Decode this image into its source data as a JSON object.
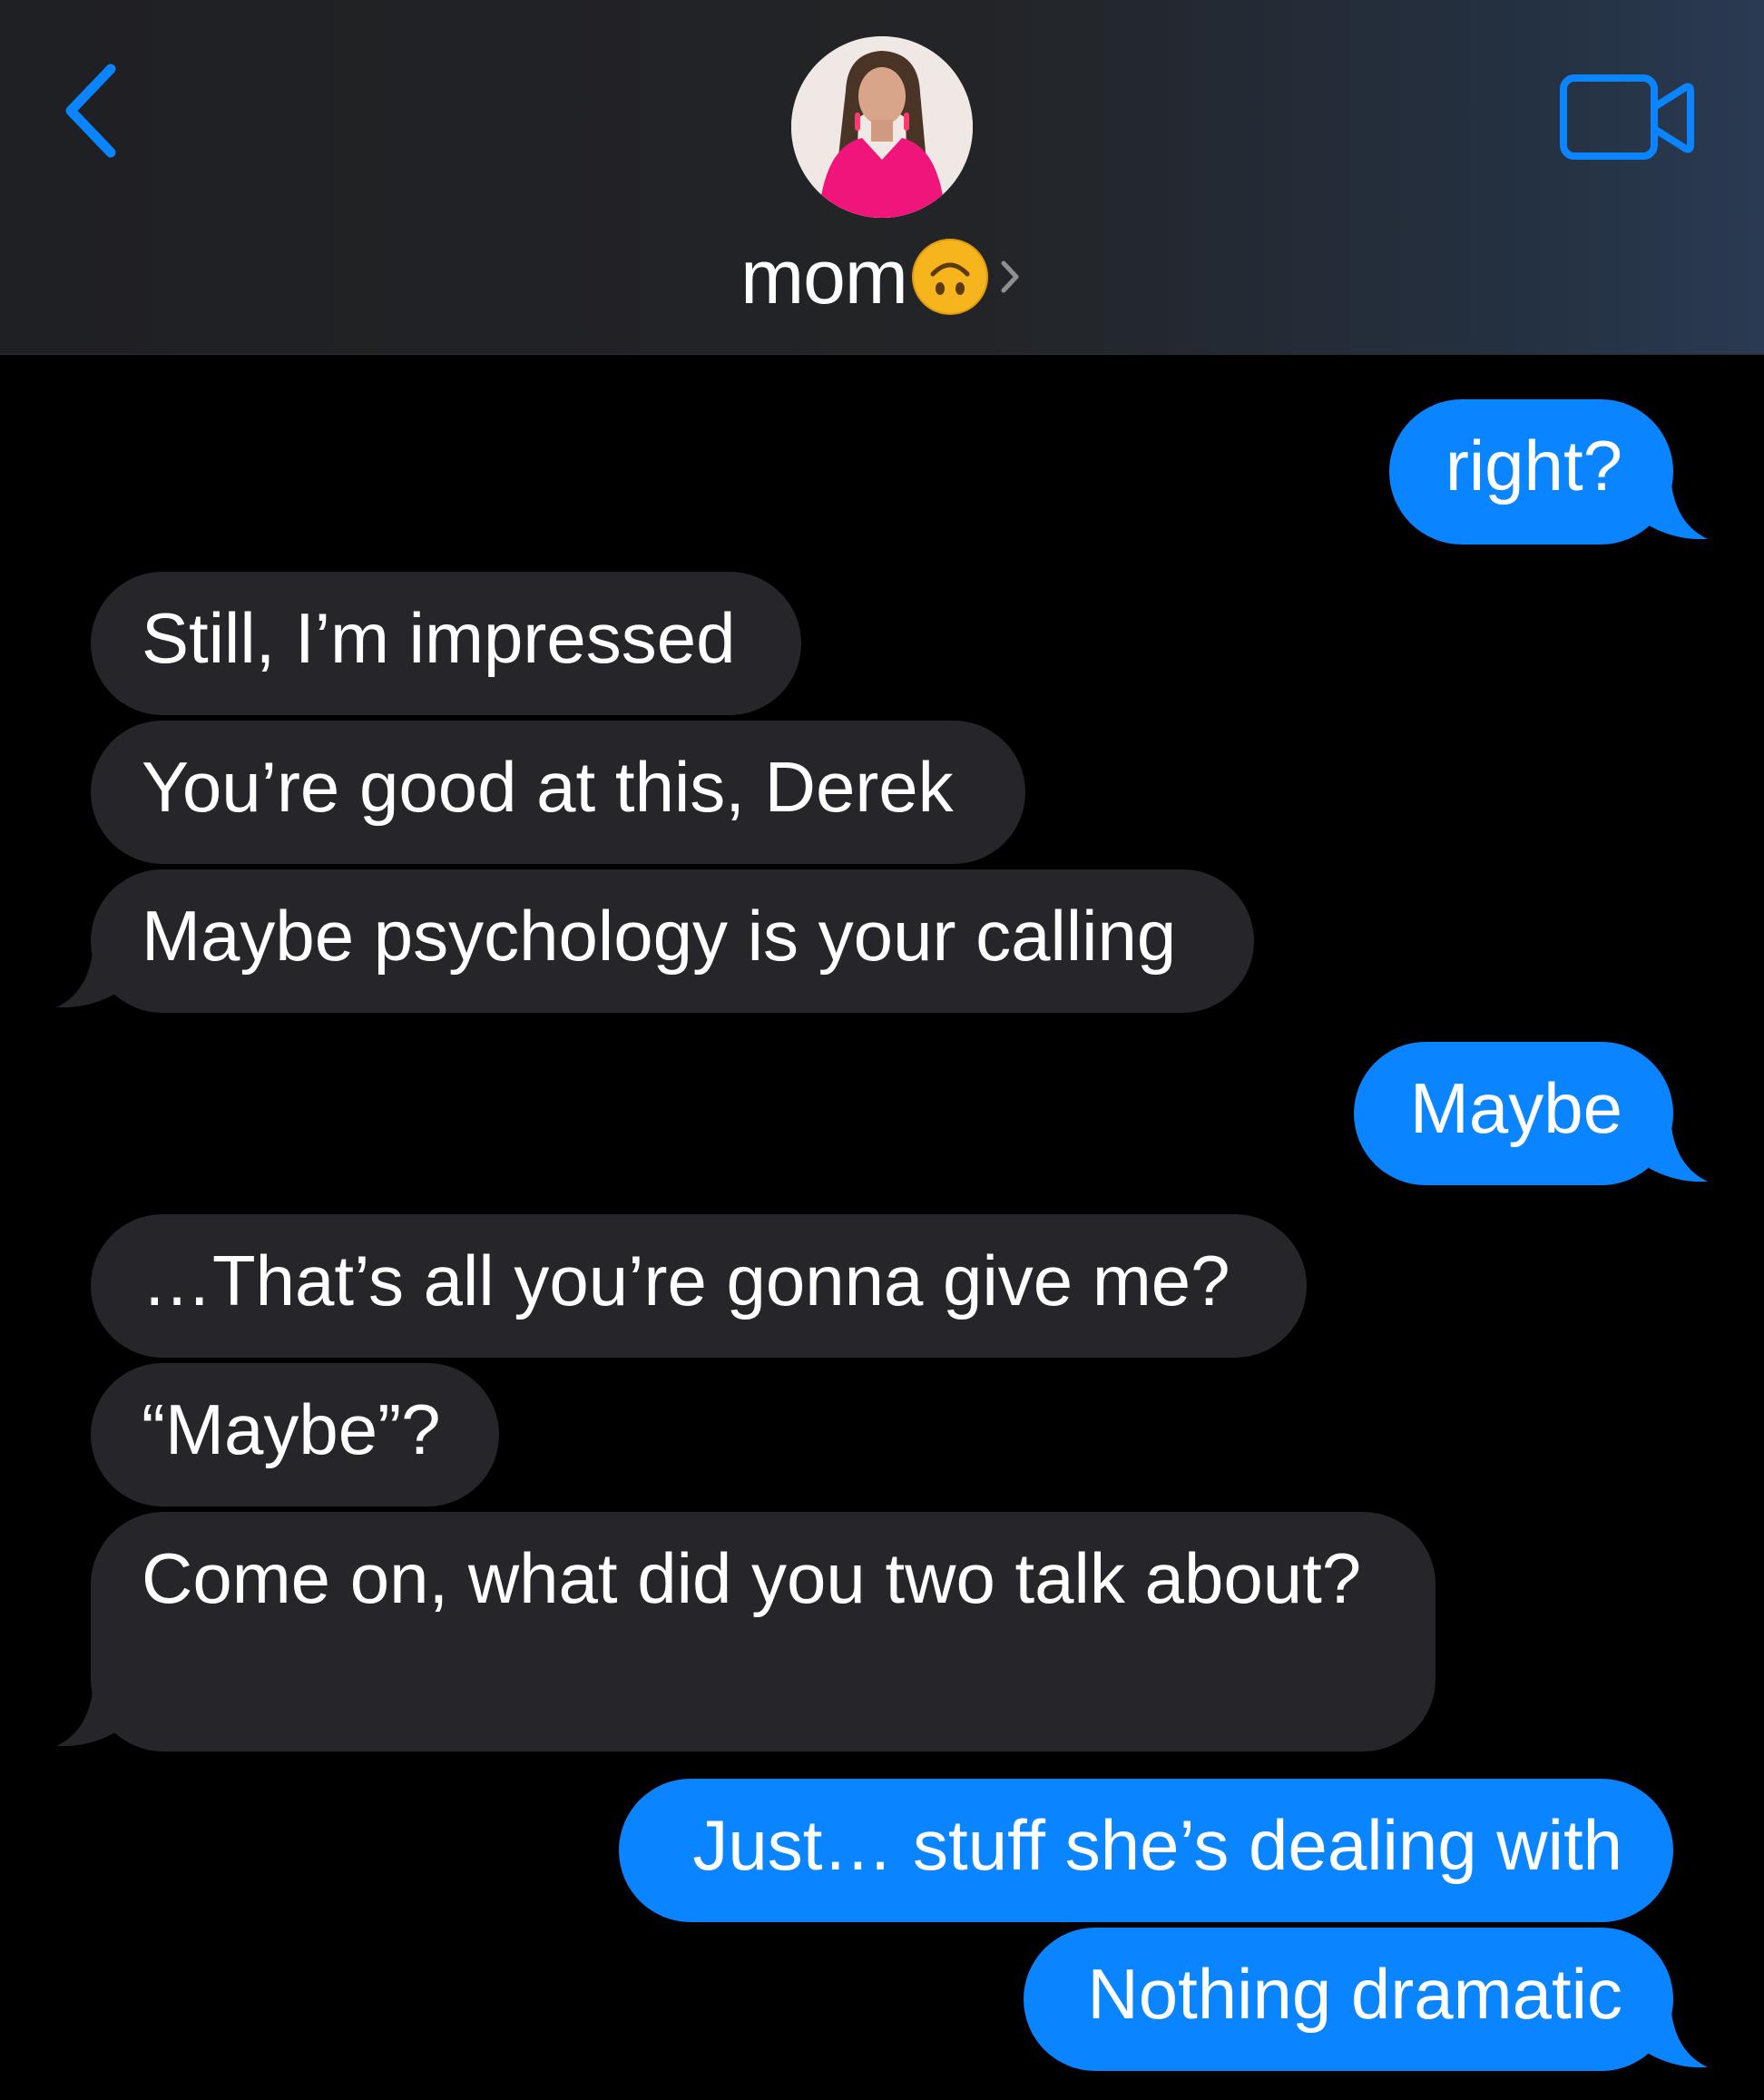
{
  "header": {
    "contact_name": "mom",
    "contact_emoji": "upside-down-face",
    "back_icon": "chevron-left-icon",
    "video_icon": "video-camera-icon"
  },
  "colors": {
    "accent": "#0a84ff",
    "received_bubble": "#26262a",
    "background": "#000000",
    "header_bg": "#222326"
  },
  "messages": [
    {
      "from": "me",
      "text": "right?"
    },
    {
      "from": "them",
      "text": "Still, I’m impressed"
    },
    {
      "from": "them",
      "text": "You’re good at this, Derek"
    },
    {
      "from": "them",
      "text": "Maybe psychology is your calling"
    },
    {
      "from": "me",
      "text": "Maybe"
    },
    {
      "from": "them",
      "text": "…That’s all you’re gonna give me?"
    },
    {
      "from": "them",
      "text": "“Maybe”?"
    },
    {
      "from": "them",
      "text": "Come on, what did you two talk about?"
    },
    {
      "from": "me",
      "text": "Just… stuff she’s dealing with"
    },
    {
      "from": "me",
      "text": "Nothing dramatic"
    }
  ]
}
